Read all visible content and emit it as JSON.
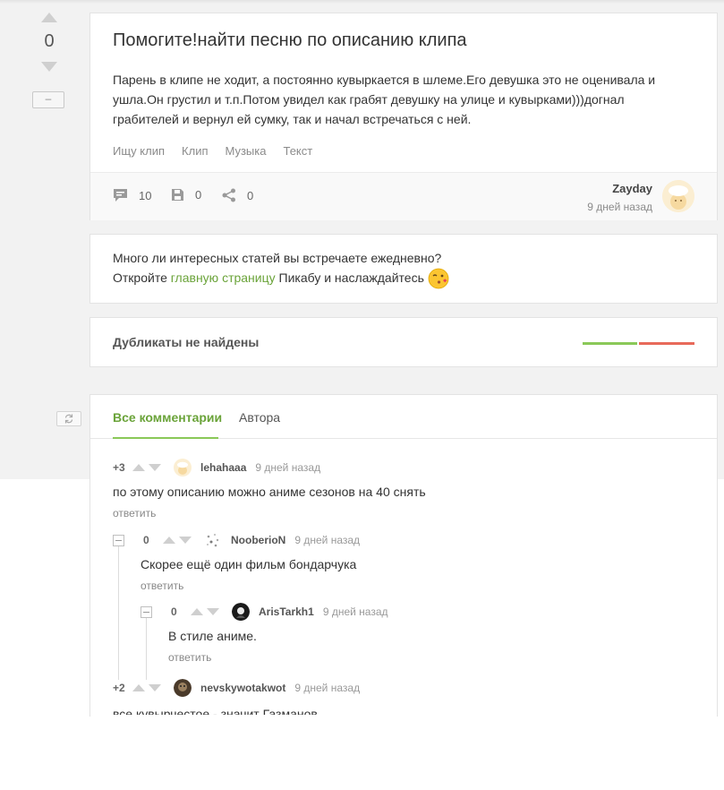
{
  "post": {
    "rating": "0",
    "collapse_label": "–",
    "title": "Помогите!найти песню по описанию клипа",
    "body": "Парень в клипе не ходит, а постоянно кувыркается в шлеме.Его девушка это не оценивала и ушла.Он грустил и т.п.Потом увидел как грабят девушку на улице и кувырками)))догнал грабителей и вернул ей сумку, так и начал встречаться с ней.",
    "tags": [
      "Ищу клип",
      "Клип",
      "Музыка",
      "Текст"
    ],
    "comments_count": "10",
    "saves_count": "0",
    "shares_count": "0",
    "author": "Zayday",
    "time": "9 дней назад"
  },
  "promo": {
    "line1": "Много ли интересных статей вы встречаете ежедневно?",
    "line2_before": "Откройте ",
    "link": "главную страницу",
    "line2_after": " Пикабу и наслаждайтесь"
  },
  "duplicates": {
    "text": "Дубликаты не найдены"
  },
  "comments_tabs": {
    "all": "Все комментарии",
    "author": "Автора"
  },
  "comments": [
    {
      "rating": "+3",
      "user": "lehahaaa",
      "time": "9 дней назад",
      "text": "по этому описанию можно аниме сезонов на 40 снять",
      "reply": "ответить"
    },
    {
      "rating": "0",
      "user": "NooberioN",
      "time": "9 дней назад",
      "text": "Скорее ещё один фильм бондарчука",
      "reply": "ответить"
    },
    {
      "rating": "0",
      "user": "ArisTarkh1",
      "time": "9 дней назад",
      "text": "В стиле аниме.",
      "reply": "ответить"
    },
    {
      "rating": "+2",
      "user": "nevskywotakwot",
      "time": "9 дней назад",
      "text": "все кувырчестое - значит Газманов"
    }
  ],
  "colors": {
    "accent_green": "#6aa339",
    "bar_green": "#8ac858",
    "bar_red": "#e86a5a"
  }
}
